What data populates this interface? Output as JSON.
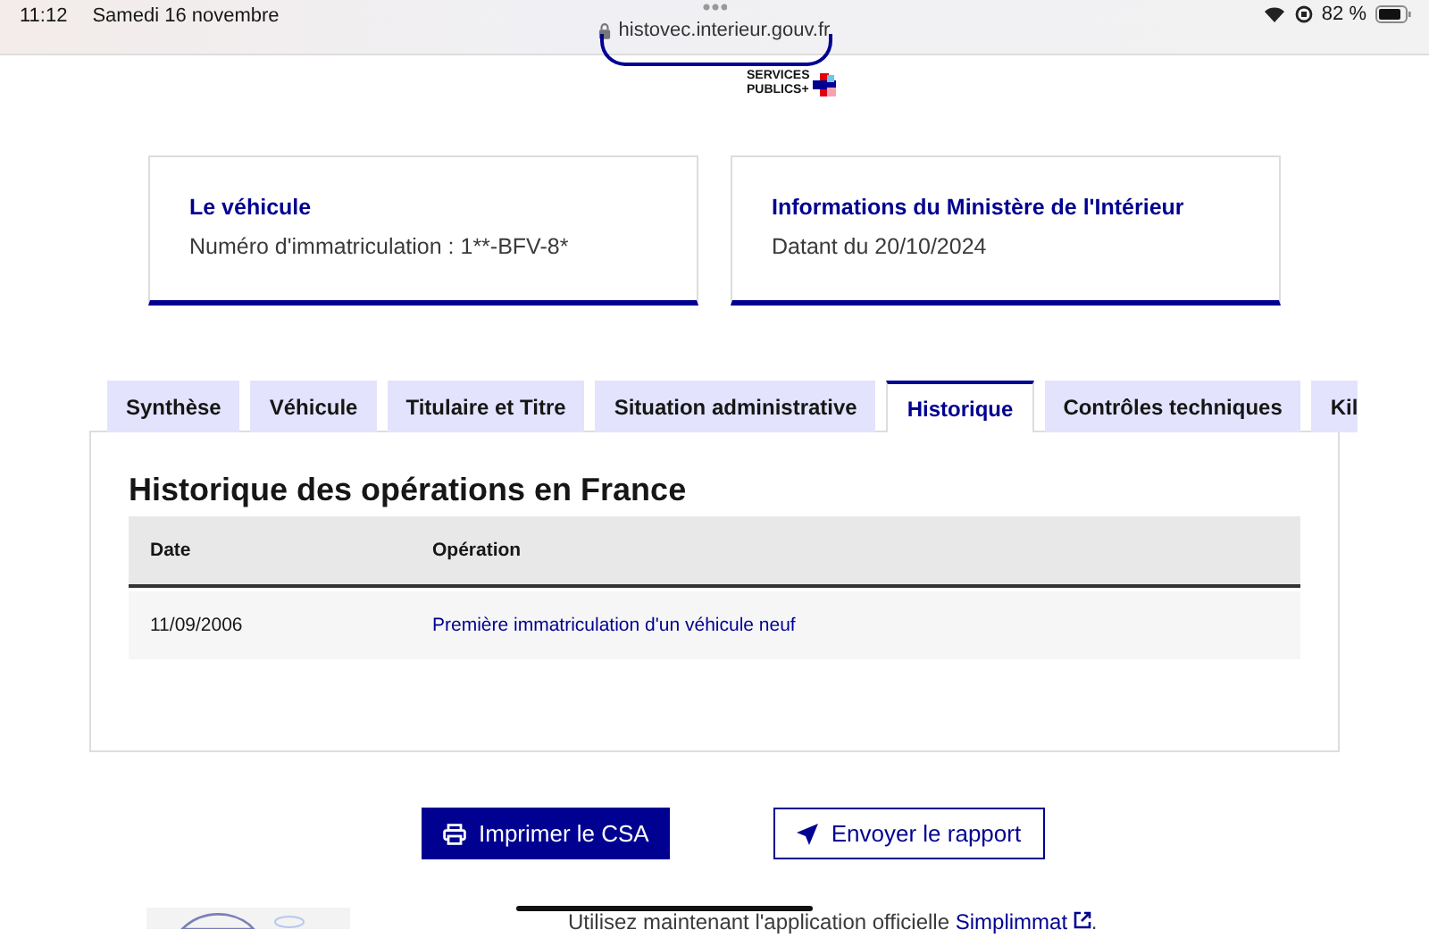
{
  "status_bar": {
    "time": "11:12",
    "date": "Samedi 16 novembre",
    "url": "histovec.interieur.gouv.fr",
    "battery": "82 %"
  },
  "logo": {
    "line_1": "SERVICES",
    "line_2": "PUBLICS+"
  },
  "cards": [
    {
      "title": "Le véhicule",
      "text": "Numéro d'immatriculation : 1**-BFV-8*"
    },
    {
      "title": "Informations du Ministère de l'Intérieur",
      "text": "Datant du 20/10/2024"
    }
  ],
  "tabs": [
    {
      "label": "Synthèse",
      "selected": false
    },
    {
      "label": "Véhicule",
      "selected": false
    },
    {
      "label": "Titulaire et Titre",
      "selected": false
    },
    {
      "label": "Situation administrative",
      "selected": false
    },
    {
      "label": "Historique",
      "selected": true
    },
    {
      "label": "Contrôles techniques",
      "selected": false
    },
    {
      "label": "Kil",
      "selected": false
    }
  ],
  "panel": {
    "title": "Historique des opérations en France",
    "table": {
      "columns": [
        "Date",
        "Opération"
      ],
      "rows": [
        [
          "11/09/2006",
          "Première immatriculation d'un véhicule neuf"
        ]
      ]
    }
  },
  "buttons": [
    {
      "label": "Imprimer le CSA",
      "kind": "primary"
    },
    {
      "label": "Envoyer le rapport",
      "kind": "secondary"
    }
  ],
  "footer": {
    "text": "Utilisez maintenant l'application officielle",
    "link": "Simplimmat",
    "after": "."
  }
}
